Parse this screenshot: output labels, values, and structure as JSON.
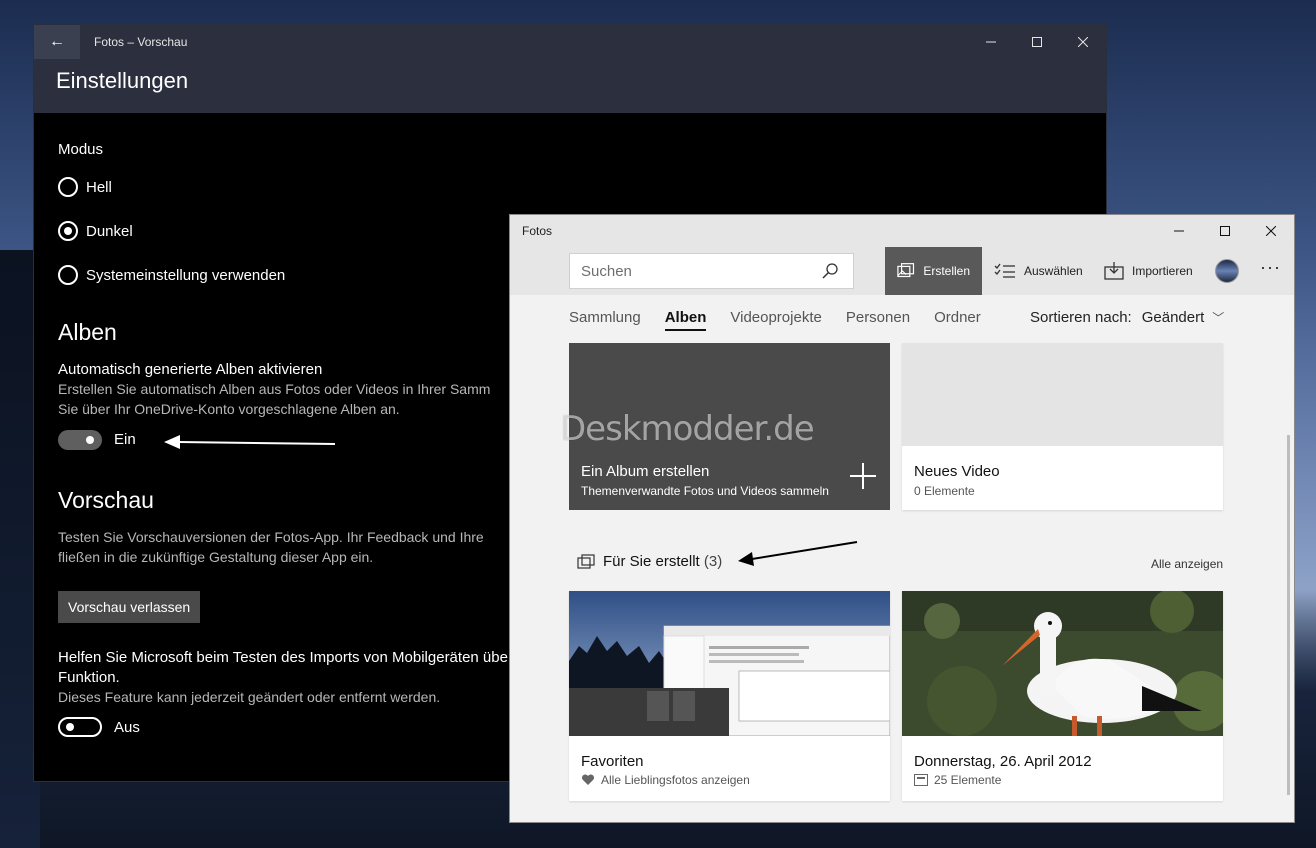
{
  "settings": {
    "window_title": "Fotos – Vorschau",
    "page_title": "Einstellungen",
    "mode_label": "Modus",
    "mode_options": [
      "Hell",
      "Dunkel",
      "Systemeinstellung verwenden"
    ],
    "mode_selected": "Dunkel",
    "albums_heading": "Alben",
    "auto_albums_label": "Automatisch generierte Alben aktivieren",
    "auto_albums_desc1": "Erstellen Sie automatisch Alben aus Fotos oder Videos in Ihrer Samm",
    "auto_albums_desc2": "Sie über Ihr OneDrive-Konto vorgeschlagene Alben an.",
    "auto_albums_toggle": "Ein",
    "preview_heading": "Vorschau",
    "preview_desc1": "Testen Sie Vorschauversionen der Fotos-App. Ihr Feedback und Ihre",
    "preview_desc2": "fließen in die zukünftige Gestaltung dieser App ein.",
    "preview_button": "Vorschau verlassen",
    "import_label1": "Helfen Sie Microsoft beim Testen des Imports von Mobilgeräten übe",
    "import_label2": "Funktion.",
    "import_desc": "Dieses Feature kann jederzeit geändert oder entfernt werden.",
    "import_toggle": "Aus"
  },
  "photos": {
    "window_title": "Fotos",
    "search_placeholder": "Suchen",
    "toolbar": {
      "create": "Erstellen",
      "select": "Auswählen",
      "import": "Importieren"
    },
    "nav": [
      "Sammlung",
      "Alben",
      "Videoprojekte",
      "Personen",
      "Ordner"
    ],
    "nav_active": "Alben",
    "sort_label": "Sortieren nach:",
    "sort_value": "Geändert",
    "create_album_title": "Ein Album erstellen",
    "create_album_sub": "Themenverwandte Fotos und Videos sammeln",
    "new_video_title": "Neues Video",
    "new_video_sub": "0 Elemente",
    "watermark": "Deskmodder.de",
    "for_you_heading": "Für Sie erstellt",
    "for_you_count": "(3)",
    "see_all": "Alle anzeigen",
    "cards": [
      {
        "title": "Favoriten",
        "sub": "Alle Lieblingsfotos anzeigen",
        "icon": "heart-icon"
      },
      {
        "title": "Donnerstag, 26. April 2012",
        "sub": "25 Elemente",
        "icon": "album-icon"
      }
    ]
  },
  "colors": {
    "settings_bg": "#000000",
    "settings_header": "#2b2f3e",
    "photos_bg": "#f2f2f2",
    "active_toolbar": "#595959",
    "create_tile": "#4a4a4a"
  }
}
